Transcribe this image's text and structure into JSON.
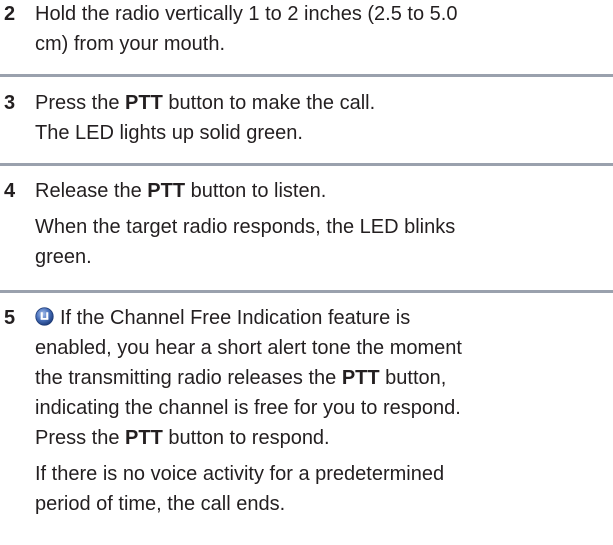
{
  "steps": [
    {
      "number": "2",
      "lines": [
        "Hold the radio vertically 1 to 2 inches (2.5 to 5.0",
        "cm) from your mouth."
      ]
    },
    {
      "number": "3",
      "line1_pre": "Press the ",
      "line1_bold": "PTT",
      "line1_post": " button to make the call.",
      "line2": "The LED lights up solid green."
    },
    {
      "number": "4",
      "line1_pre": "Release the ",
      "line1_bold": "PTT",
      "line1_post": " button to listen.",
      "para2_line1": "When the target radio responds, the LED blinks",
      "para2_line2": "green."
    },
    {
      "number": "5",
      "icon": "digital-mode-icon",
      "l1": "If the Channel Free Indication feature is",
      "l2": "enabled, you hear a short alert tone the moment",
      "l3_pre": "the transmitting radio releases the ",
      "l3_bold": "PTT",
      "l3_post": " button,",
      "l4": "indicating the channel is free for you to respond.",
      "l5_pre": "Press the ",
      "l5_bold": "PTT",
      "l5_post": " button to respond.",
      "p2_l1": "If there is no voice activity for a predetermined",
      "p2_l2": "period of time, the call ends."
    }
  ],
  "colors": {
    "text": "#231f20",
    "divider": "#9aa1ad",
    "icon_fill": "#3f68b4"
  }
}
